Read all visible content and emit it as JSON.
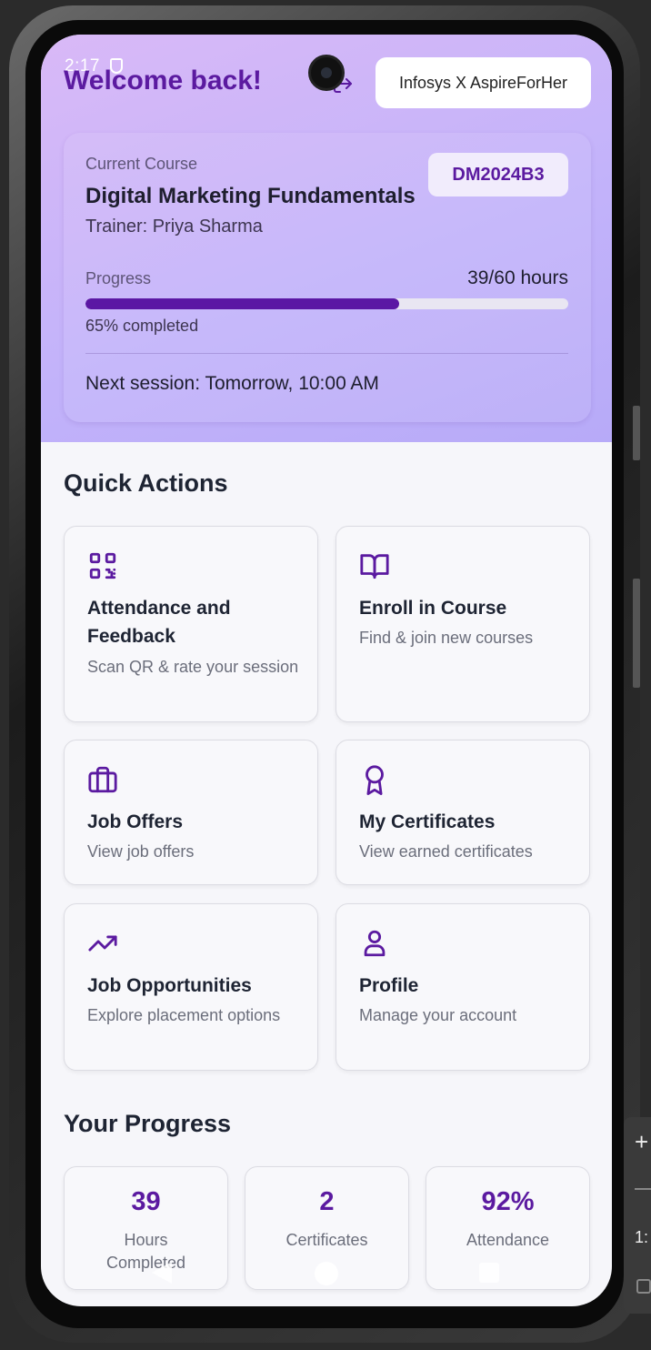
{
  "status_bar": {
    "time": "2:17"
  },
  "header": {
    "welcome": "Welcome back!",
    "org_badge": "Infosys X AspireForHer"
  },
  "course": {
    "label": "Current Course",
    "code": "DM2024B3",
    "title": "Digital Marketing Fundamentals",
    "trainer": "Trainer: Priya Sharma",
    "progress_label": "Progress",
    "progress_value": "39/60 hours",
    "progress_fraction": 0.65,
    "completed_text": "65% completed",
    "next_session": "Next session: Tomorrow, 10:00 AM"
  },
  "quick_actions": {
    "title": "Quick Actions",
    "items": [
      {
        "name": "Attendance and Feedback",
        "desc": "Scan QR & rate your session",
        "icon": "qr-code-icon"
      },
      {
        "name": "Enroll in Course",
        "desc": "Find & join new courses",
        "icon": "book-open-icon"
      },
      {
        "name": "Job Offers",
        "desc": "View job offers",
        "icon": "briefcase-icon"
      },
      {
        "name": "My Certificates",
        "desc": "View earned certificates",
        "icon": "award-icon"
      },
      {
        "name": "Job Opportunities",
        "desc": "Explore placement options",
        "icon": "trending-up-icon"
      },
      {
        "name": "Profile",
        "desc": "Manage your account",
        "icon": "user-icon"
      }
    ]
  },
  "your_progress": {
    "title": "Your Progress",
    "stats": [
      {
        "value": "39",
        "label": "Hours Completed"
      },
      {
        "value": "2",
        "label": "Certificates"
      },
      {
        "value": "92%",
        "label": "Attendance"
      }
    ]
  },
  "colors": {
    "accent": "#5b1aa0",
    "header_gradient_start": "#d9b9f7",
    "header_gradient_end": "#b7aaf8"
  }
}
